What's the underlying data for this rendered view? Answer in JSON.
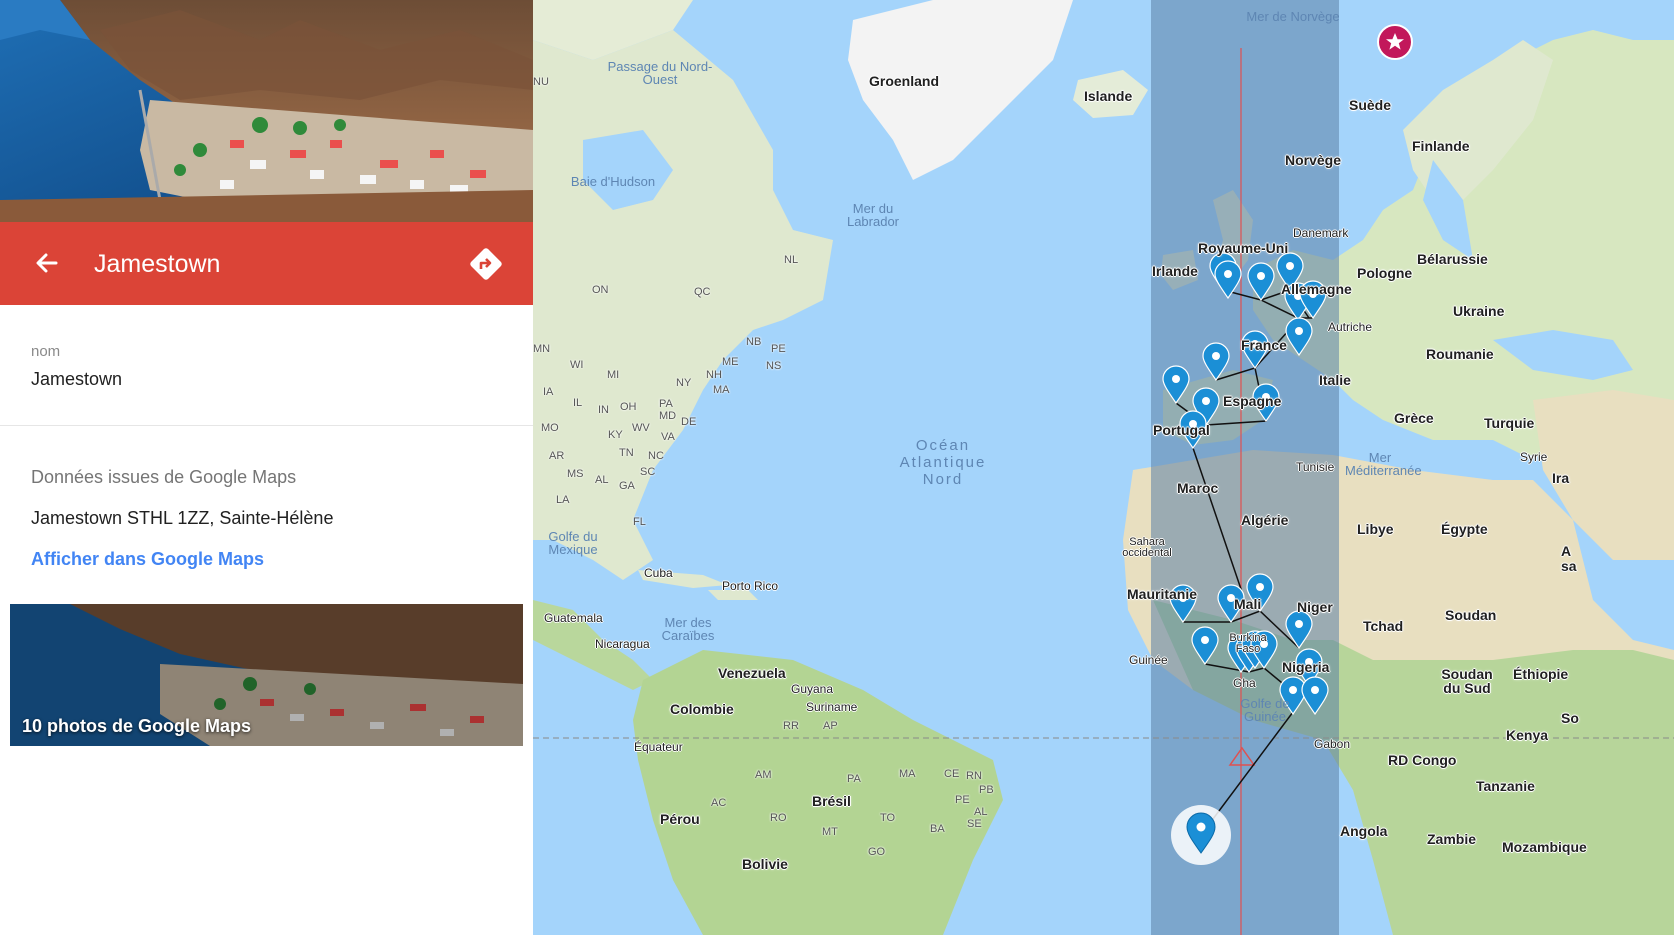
{
  "panel": {
    "title": "Jamestown",
    "name_label": "nom",
    "name_value": "Jamestown",
    "gmaps_heading": "Données issues de Google Maps",
    "address": "Jamestown STHL 1ZZ, Sainte-Hélène",
    "view_link": "Afficher dans Google Maps",
    "photos_caption": "10 photos de Google Maps",
    "header_color": "#db4437",
    "link_color": "#4285f4"
  },
  "icons": {
    "back": "arrow-left-icon",
    "directions": "directions-icon",
    "pin": "map-pin-icon",
    "star": "star-pin-icon"
  },
  "map": {
    "water_color": "#a4d4fb",
    "band_color": "#5b7fa6",
    "countries": [
      "Groenland",
      "Islande",
      "Suède",
      "Finlande",
      "Norvège",
      "Danemark",
      "Royaume-Uni",
      "Irlande",
      "Pologne",
      "Bélarussie",
      "Ukraine",
      "Allemagne",
      "Autriche",
      "France",
      "Roumanie",
      "Italie",
      "Espagne",
      "Portugal",
      "Grèce",
      "Turquie",
      "Tunisie",
      "Maroc",
      "Algérie",
      "Libye",
      "Égypte",
      "Sahara occidental",
      "Mauritanie",
      "Mali",
      "Niger",
      "Tchad",
      "Soudan",
      "Burkina Faso",
      "Guinée",
      "Nigeria",
      "Soudan du Sud",
      "Éthiopie",
      "Kenya",
      "RD Congo",
      "Tanzanie",
      "Angola",
      "Zambie",
      "Mozambique",
      "Gabon",
      "Syrie",
      "Ira",
      "Venezuela",
      "Guyana",
      "Suriname",
      "Colombie",
      "Équateur",
      "Pérou",
      "Brésil",
      "Bolivie",
      "Cuba",
      "Porto Rico",
      "Guatemala",
      "Nicaragua",
      "Somalie",
      "Ghana"
    ],
    "seas": [
      "Mer de Norvège",
      "Passage du Nord-Ouest",
      "Baie d'Hudson",
      "Mer du Labrador",
      "Océan Atlantique Nord",
      "Golfe du Mexique",
      "Mer des Caraïbes",
      "Mer Méditerranée",
      "Golfe de Guinée"
    ],
    "regions": [
      "NU",
      "ON",
      "QC",
      "NL",
      "NB",
      "PE",
      "NS",
      "MN",
      "WI",
      "MI",
      "NY",
      "NH",
      "ME",
      "MA",
      "IA",
      "IL",
      "IN",
      "OH",
      "PA",
      "MD",
      "DE",
      "MO",
      "KY",
      "WV",
      "VA",
      "AR",
      "TN",
      "NC",
      "MS",
      "AL",
      "GA",
      "SC",
      "LA",
      "FL",
      "RR",
      "AP",
      "AM",
      "PA",
      "MA",
      "CE",
      "RN",
      "PB",
      "PE",
      "AL",
      "AC",
      "RO",
      "MT",
      "TO",
      "BA",
      "SE",
      "GO"
    ]
  }
}
